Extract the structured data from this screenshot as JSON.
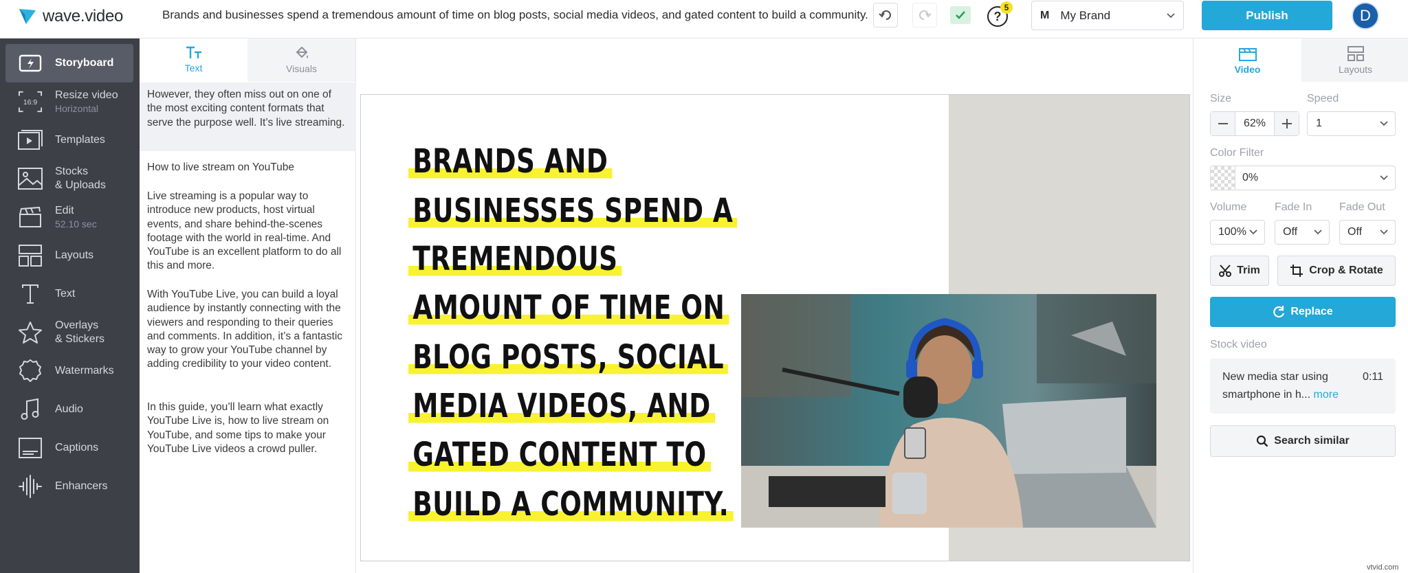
{
  "app": {
    "name": "wave.video",
    "project_title": "Brands and businesses spend a tremendous amount of time on blog posts, social media videos, and gated content to build a community."
  },
  "toolbar": {
    "help_count": "5",
    "brand_initial": "M",
    "brand_name": "My Brand",
    "publish_label": "Publish",
    "avatar_initial": "D"
  },
  "sidebar": {
    "items": [
      {
        "label": "Storyboard",
        "sub": "",
        "icon": "storyboard-icon",
        "active": true
      },
      {
        "label": "Resize video",
        "sub": "Horizontal",
        "icon": "resize-icon"
      },
      {
        "label": "Templates",
        "sub": "",
        "icon": "templates-icon"
      },
      {
        "label": "Stocks",
        "label2": "& Uploads",
        "icon": "stocks-icon"
      },
      {
        "label": "Edit",
        "sub": "52.10 sec",
        "icon": "edit-clapper-icon"
      },
      {
        "label": "Layouts",
        "sub": "",
        "icon": "layouts-icon"
      },
      {
        "label": "Text",
        "sub": "",
        "icon": "text-icon"
      },
      {
        "label": "Overlays",
        "label2": "& Stickers",
        "icon": "star-icon"
      },
      {
        "label": "Watermarks",
        "sub": "",
        "icon": "watermark-icon"
      },
      {
        "label": "Audio",
        "sub": "",
        "icon": "music-note-icon"
      },
      {
        "label": "Captions",
        "sub": "",
        "icon": "captions-icon"
      },
      {
        "label": "Enhancers",
        "sub": "",
        "icon": "waveform-icon"
      }
    ],
    "resize_badge": "16:9"
  },
  "text_panel": {
    "tabs": [
      {
        "label": "Text"
      },
      {
        "label": "Visuals"
      }
    ],
    "paragraphs": [
      "However, they often miss out on one of the most exciting content formats that serve the purpose well. It’s live streaming.",
      "How to live stream on YouTube",
      "Live streaming is a popular way to introduce new products, host virtual events, and share behind-the-scenes footage with the world in real-time. And YouTube is an excellent platform to do all this and more.",
      "With YouTube Live, you can build a loyal audience by instantly connecting with the viewers and responding to their queries and comments. In addition, it’s a fantastic way to grow your YouTube channel by adding credibility to your video content.",
      "In this guide, you’ll learn what exactly YouTube Live is, how to live stream on YouTube, and some tips to make your YouTube Live videos a crowd puller."
    ]
  },
  "canvas": {
    "headline_lines": [
      "BRANDS AND",
      "BUSINESSES SPEND A",
      "TREMENDOUS",
      "AMOUNT OF TIME ON",
      "BLOG POSTS, SOCIAL",
      "MEDIA VIDEOS, AND",
      "GATED CONTENT TO",
      "BUILD A COMMUNITY."
    ],
    "highlight_color": "#f8f230"
  },
  "right_panel": {
    "tabs": [
      {
        "label": "Video"
      },
      {
        "label": "Layouts"
      }
    ],
    "size_label": "Size",
    "size_value": "62%",
    "speed_label": "Speed",
    "speed_value": "1",
    "color_filter_label": "Color Filter",
    "color_filter_value": "0%",
    "volume_label": "Volume",
    "volume_value": "100%",
    "fade_in_label": "Fade In",
    "fade_in_value": "Off",
    "fade_out_label": "Fade Out",
    "fade_out_value": "Off",
    "trim_label": "Trim",
    "crop_label": "Crop & Rotate",
    "replace_label": "Replace",
    "stock_label": "Stock video",
    "stock_title": "New media star using smartphone in h...",
    "stock_more": "more",
    "stock_duration": "0:11",
    "search_similar_label": "Search similar"
  },
  "watermark": "vtvid.com",
  "colors": {
    "accent": "#23a8d8",
    "sidebar_bg": "#3d4047"
  }
}
